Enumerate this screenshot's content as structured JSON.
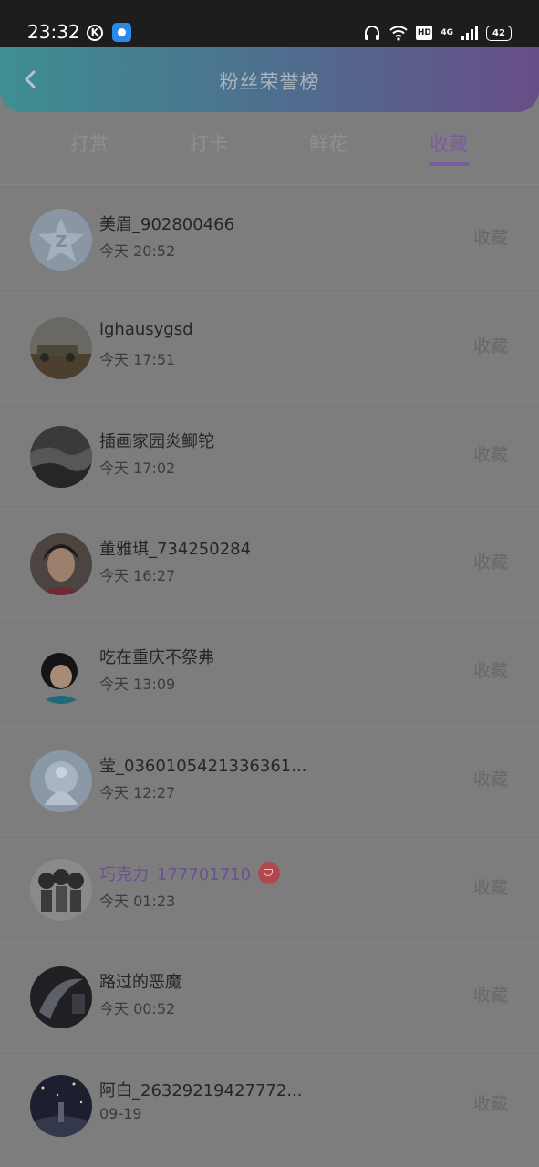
{
  "status_bar": {
    "time": "23:32",
    "k_icon": "K",
    "hd": "HD",
    "network": "4G",
    "battery": "42"
  },
  "header": {
    "title": "粉丝荣誉榜"
  },
  "tabs": [
    {
      "label": "打赏",
      "active": false
    },
    {
      "label": "打卡",
      "active": false
    },
    {
      "label": "鲜花",
      "active": false
    },
    {
      "label": "收藏",
      "active": true
    }
  ],
  "fans": [
    {
      "name": "美眉_902800466",
      "time": "今天 20:52",
      "action": "收藏",
      "avatar": "default-avatar"
    },
    {
      "name": "lghausygsd",
      "time": "今天 17:51",
      "action": "收藏",
      "avatar": "vehicle-photo"
    },
    {
      "name": "插画家园炎鲫铊",
      "time": "今天 17:02",
      "action": "收藏",
      "avatar": "landscape-photo"
    },
    {
      "name": "董雅琪_734250284",
      "time": "今天 16:27",
      "action": "收藏",
      "avatar": "portrait-photo"
    },
    {
      "name": "吃在重庆不祭弗",
      "time": "今天 13:09",
      "action": "收藏",
      "avatar": "child-photo"
    },
    {
      "name": "莹_0360105421336361...",
      "time": "今天 12:27",
      "action": "收藏",
      "avatar": "ice-art"
    },
    {
      "name": "巧克力_177701710",
      "time": "今天 01:23",
      "action": "收藏",
      "avatar": "cartoon-group",
      "vip": true
    },
    {
      "name": "路过的恶魔",
      "time": "今天 00:52",
      "action": "收藏",
      "avatar": "dark-art"
    },
    {
      "name": "阿白_26329219427772...",
      "time": "09-19",
      "action": "收藏",
      "avatar": "night-sky"
    }
  ],
  "colors": {
    "accent": "#7b5aa0",
    "header_gradient_start": "#3e8f92",
    "header_gradient_end": "#684e88"
  }
}
